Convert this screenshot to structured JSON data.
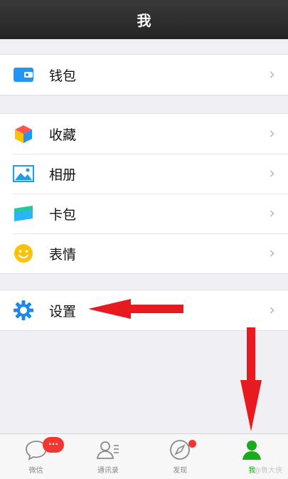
{
  "header": {
    "title": "我"
  },
  "groups": [
    {
      "items": [
        {
          "label": "钱包"
        }
      ]
    },
    {
      "items": [
        {
          "label": "收藏"
        },
        {
          "label": "相册"
        },
        {
          "label": "卡包"
        },
        {
          "label": "表情"
        }
      ]
    },
    {
      "items": [
        {
          "label": "设置"
        }
      ]
    }
  ],
  "chevron": "›",
  "tabbar": {
    "tabs": [
      {
        "label": "微信",
        "badge": "···"
      },
      {
        "label": "通讯录"
      },
      {
        "label": "发现"
      },
      {
        "label": "我"
      }
    ]
  },
  "watermark": "@鲁大侠",
  "colors": {
    "header_bg": "#2b2b2b",
    "accent_green": "#1aad19",
    "badge_red": "#f43530",
    "annotation_red": "#e8191f"
  }
}
